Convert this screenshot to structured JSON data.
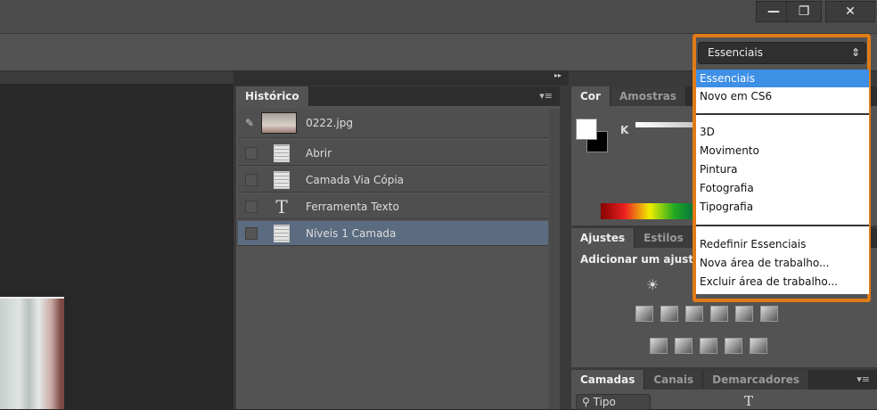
{
  "window": {
    "minimize": "—",
    "restore": "❐",
    "close": "✕"
  },
  "workspace": {
    "selected": "Essenciais",
    "arrow": "⇕",
    "options": {
      "group1": [
        "Essenciais",
        "Novo em CS6"
      ],
      "group2": [
        "3D",
        "Movimento",
        "Pintura",
        "Fotografia",
        "Tipografia"
      ],
      "group3": [
        "Redefinir Essenciais",
        "Nova área de trabalho...",
        "Excluir área de trabalho..."
      ]
    }
  },
  "collapse_icon": "▸▸",
  "history": {
    "tab": "Histórico",
    "snapshot": "0222.jpg",
    "items": [
      {
        "label": "Abrir",
        "icon": "document-icon"
      },
      {
        "label": "Camada Via Cópia",
        "icon": "document-icon"
      },
      {
        "label": "Ferramenta Texto",
        "icon": "text-icon",
        "glyph": "T"
      },
      {
        "label": "Níveis 1 Camada",
        "icon": "document-icon",
        "selected": true
      }
    ]
  },
  "color_panel": {
    "tabs": [
      "Cor",
      "Amostras"
    ],
    "slider_label": "K"
  },
  "adjustments": {
    "tabs": [
      "Ajustes",
      "Estilos"
    ],
    "title": "Adicionar um ajuste"
  },
  "layers": {
    "tabs": [
      "Camadas",
      "Canais",
      "Demarcadores"
    ],
    "filter": "Tipo",
    "filter_icon": "⚲",
    "text_glyph": "T"
  },
  "menu_icon": "▾≡",
  "colors": {
    "accent": "#e07b16",
    "highlight": "#3e8fe6",
    "selected_row": "#5b6b80"
  }
}
